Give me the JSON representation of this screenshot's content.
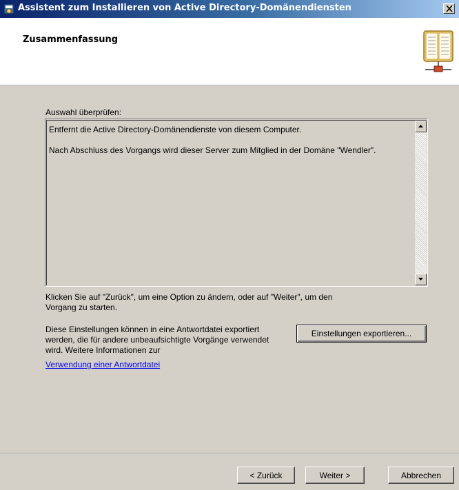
{
  "window": {
    "title": "Assistent zum Installieren von Active Directory-Domänendiensten",
    "close_icon": "close-icon",
    "app_icon": "ad-installer-icon"
  },
  "header": {
    "title": "Zusammenfassung",
    "icon": "book-network-icon"
  },
  "review": {
    "label": "Auswahl überprüfen:",
    "lines": [
      "Entfernt die Active Directory-Domänendienste von diesem Computer.",
      "Nach Abschluss des Vorgangs wird dieser Server zum Mitglied in der Domäne \"Wendler\"."
    ]
  },
  "hint": "Klicken Sie auf \"Zurück\", um eine Option zu ändern, oder auf \"Weiter\", um den Vorgang zu starten.",
  "export": {
    "description": "Diese Einstellungen können in eine Antwortdatei exportiert werden, die für andere unbeaufsichtigte Vorgänge verwendet wird. Weitere Informationen zur",
    "link": "Verwendung einer Antwortdatei",
    "button": "Einstellungen exportieren..."
  },
  "footer": {
    "back": "< Zurück",
    "next": "Weiter >",
    "cancel": "Abbrechen"
  },
  "colors": {
    "title_start": "#0a246a",
    "title_end": "#a6caf0",
    "face": "#d4d0c8",
    "link": "#0000ee"
  }
}
